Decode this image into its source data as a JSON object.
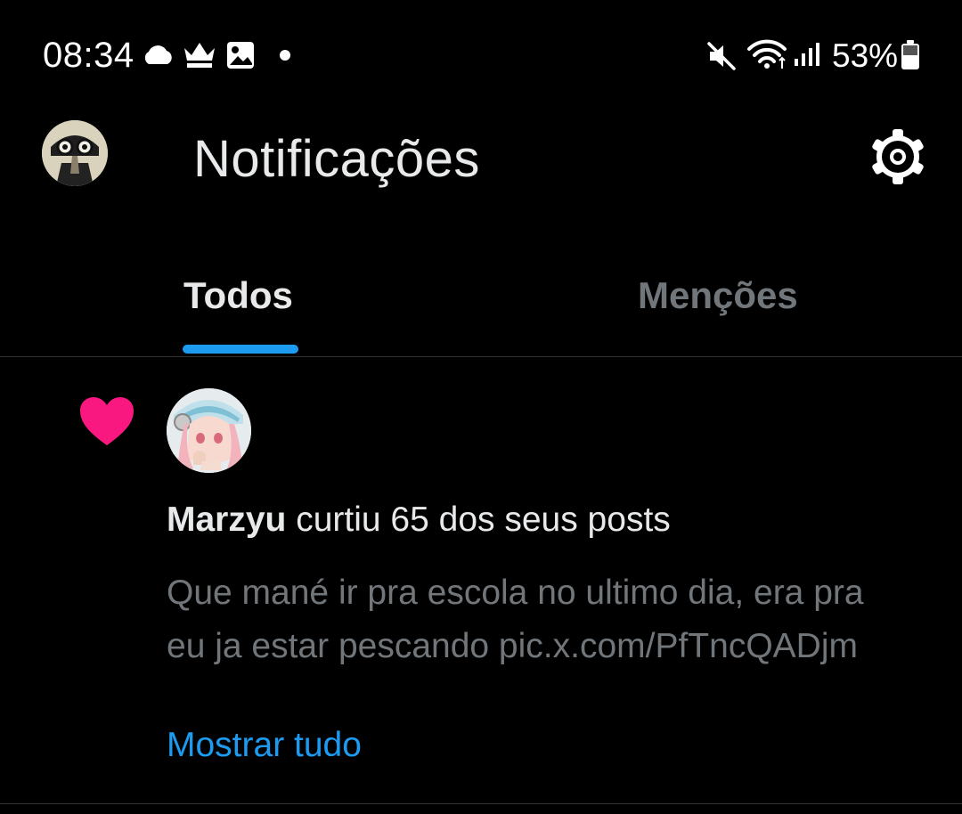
{
  "status_bar": {
    "time": "08:34",
    "battery_percent": "53%",
    "left_icons": [
      "cloud-icon",
      "crown-icon",
      "image-icon",
      "dot-icon"
    ],
    "right_icons": [
      "mute-icon",
      "wifi-icon",
      "signal-icon",
      "battery-icon"
    ]
  },
  "header": {
    "title": "Notificações",
    "avatar_icon": "avatar",
    "settings_icon": "gear-icon"
  },
  "tabs": [
    {
      "label": "Todos",
      "active": true
    },
    {
      "label": "Menções",
      "active": false
    }
  ],
  "notification": {
    "icon": "heart-icon",
    "user": "Marzyu",
    "action": " curtiu 65 dos seus posts",
    "post_text": "Que mané ir pra escola no ultimo dia, era pra eu ja estar pescando pic.x.com/PfTncQADjm",
    "show_more": "Mostrar tudo"
  },
  "colors": {
    "background": "#000000",
    "accent": "#1d9bf0",
    "heart": "#f91880",
    "muted_text": "#71767b",
    "primary_text": "#e7e9ea"
  }
}
